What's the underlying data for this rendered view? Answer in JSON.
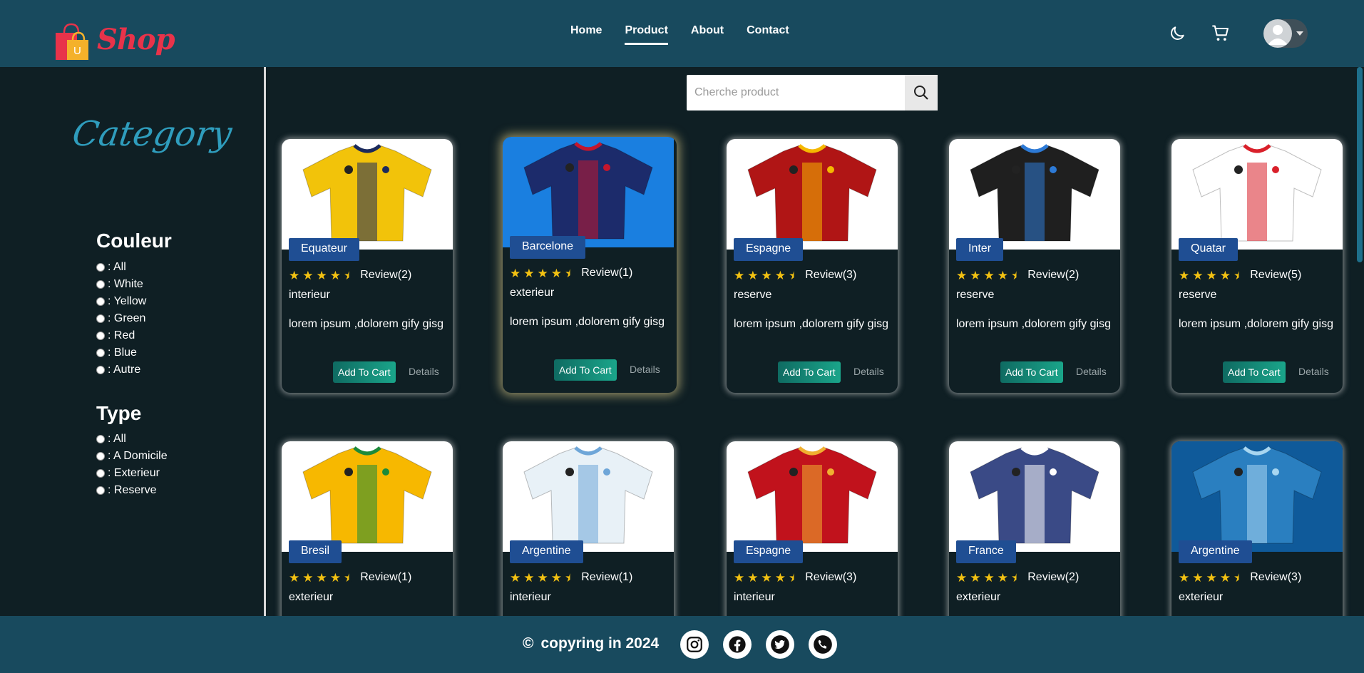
{
  "header": {
    "logo_text": "Shop",
    "logo_letter": "U",
    "nav": [
      "Home",
      "Product",
      "About",
      "Contact"
    ],
    "active_nav": "Product",
    "icons": [
      "moon-icon",
      "cart-icon",
      "user-avatar-icon",
      "caret-down-icon"
    ]
  },
  "sidebar": {
    "category_title": "Category",
    "couleur_title": "Couleur",
    "couleur_options": [
      ": All",
      ": White",
      ": Yellow",
      ": Green",
      ": Red",
      ": Blue",
      ": Autre"
    ],
    "type_title": "Type",
    "type_options": [
      ": All",
      ": A Domicile",
      ": Exterieur",
      ": Reserve"
    ]
  },
  "search": {
    "placeholder": "Cherche product",
    "icon": "search-icon"
  },
  "card_actions": {
    "add_to_cart": "Add To Cart",
    "details": "Details"
  },
  "products": [
    {
      "team": "Equateur",
      "review": "Review(2)",
      "rating": 4.5,
      "type": "interieur",
      "desc": "lorem ipsum ,dolorem gify gisg",
      "colors": [
        "#f2c30a",
        "#1b2a5c"
      ],
      "bg": "#ffffff"
    },
    {
      "team": "Barcelone",
      "review": "Review(1)",
      "rating": 4.5,
      "type": "exterieur",
      "desc": "lorem ipsum ,dolorem gify gisg",
      "colors": [
        "#1c2b6b",
        "#c4162c"
      ],
      "bg": "#1a7fe0"
    },
    {
      "team": "Espagne",
      "review": "Review(3)",
      "rating": 4.5,
      "type": "reserve",
      "desc": "lorem ipsum ,dolorem gify gisg",
      "colors": [
        "#b01515",
        "#f5b800"
      ],
      "bg": "#ffffff"
    },
    {
      "team": "Inter",
      "review": "Review(2)",
      "rating": 4.5,
      "type": "reserve",
      "desc": "lorem ipsum ,dolorem gify gisg",
      "colors": [
        "#1f1f1f",
        "#2d7ad6"
      ],
      "bg": "#ffffff"
    },
    {
      "team": "Quatar",
      "review": "Review(5)",
      "rating": 4.5,
      "type": "reserve",
      "desc": "lorem ipsum ,dolorem gify gisg",
      "colors": [
        "#ffffff",
        "#d9202a"
      ],
      "bg": "#ffffff"
    },
    {
      "team": "Bresil",
      "review": "Review(1)",
      "rating": 4.5,
      "type": "exterieur",
      "desc": "",
      "colors": [
        "#f7b800",
        "#1c8a3a"
      ],
      "bg": "#ffffff"
    },
    {
      "team": "Argentine",
      "review": "Review(1)",
      "rating": 4.5,
      "type": "interieur",
      "desc": "",
      "colors": [
        "#e8f1f7",
        "#6ea6d8"
      ],
      "bg": "#ffffff"
    },
    {
      "team": "Espagne",
      "review": "Review(3)",
      "rating": 4.5,
      "type": "interieur",
      "desc": "",
      "colors": [
        "#c1121c",
        "#f0b030"
      ],
      "bg": "#ffffff"
    },
    {
      "team": "France",
      "review": "Review(2)",
      "rating": 4.5,
      "type": "exterieur",
      "desc": "",
      "colors": [
        "#3a4a86",
        "#ffffff"
      ],
      "bg": "#ffffff"
    },
    {
      "team": "Argentine",
      "review": "Review(3)",
      "rating": 4.5,
      "type": "exterieur",
      "desc": "",
      "colors": [
        "#2a7fc0",
        "#a8d6f0"
      ],
      "bg": "#0f5a9a"
    }
  ],
  "footer": {
    "copyright": "copyring in 2024",
    "copyright_symbol": "©",
    "social": [
      "instagram-icon",
      "facebook-icon",
      "twitter-icon",
      "phone-icon"
    ]
  }
}
